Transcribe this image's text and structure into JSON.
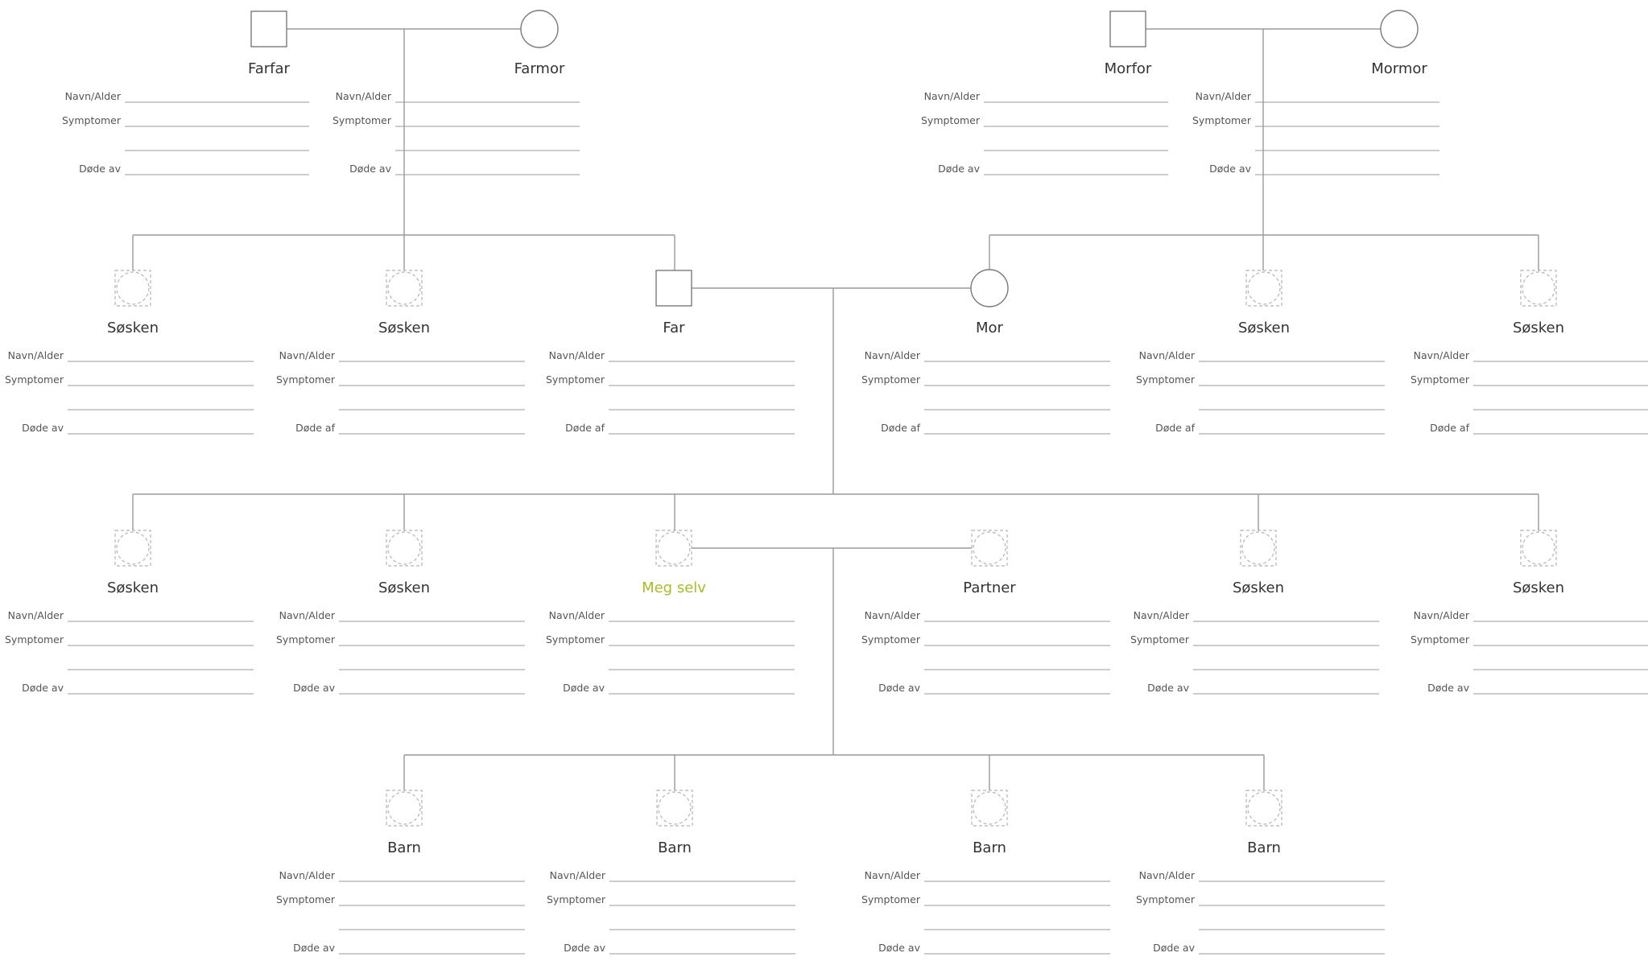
{
  "colors": {
    "line": "#9a9a9a",
    "shape": "#7a7a7a",
    "unknown_shape": "#b5b5b5",
    "self_accent": "#a9ba2a",
    "text": "#333333"
  },
  "persons": [
    {
      "id": "farfar",
      "name": "Farfar",
      "shape": "square",
      "labels": [
        "Navn/Alder",
        "Symptomer",
        "",
        "Døde av"
      ]
    },
    {
      "id": "farmor",
      "name": "Farmor",
      "shape": "circle",
      "labels": [
        "Navn/Alder",
        "Symptomer",
        "",
        "Døde av"
      ]
    },
    {
      "id": "morfor",
      "name": "Morfor",
      "shape": "square",
      "labels": [
        "Navn/Alder",
        "Symptomer",
        "",
        "Døde av"
      ]
    },
    {
      "id": "mormor",
      "name": "Mormor",
      "shape": "circle",
      "labels": [
        "Navn/Alder",
        "Symptomer",
        "",
        "Døde av"
      ]
    },
    {
      "id": "f-sib-1",
      "name": "Søsken",
      "shape": "unknown",
      "labels": [
        "Navn/Alder",
        "Symptomer",
        "",
        "Døde av"
      ]
    },
    {
      "id": "f-sib-2",
      "name": "Søsken",
      "shape": "unknown",
      "labels": [
        "Navn/Alder",
        "Symptomer",
        "",
        "Døde af"
      ]
    },
    {
      "id": "far",
      "name": "Far",
      "shape": "square",
      "labels": [
        "Navn/Alder",
        "Symptomer",
        "",
        "Døde af"
      ]
    },
    {
      "id": "mor",
      "name": "Mor",
      "shape": "circle",
      "labels": [
        "Navn/Alder",
        "Symptomer",
        "",
        "Døde af"
      ]
    },
    {
      "id": "m-sib-1",
      "name": "Søsken",
      "shape": "unknown",
      "labels": [
        "Navn/Alder",
        "Symptomer",
        "",
        "Døde af"
      ]
    },
    {
      "id": "m-sib-2",
      "name": "Søsken",
      "shape": "unknown",
      "labels": [
        "Navn/Alder",
        "Symptomer",
        "",
        "Døde af"
      ]
    },
    {
      "id": "sib-1",
      "name": "Søsken",
      "shape": "unknown",
      "labels": [
        "Navn/Alder",
        "Symptomer",
        "",
        "Døde av"
      ]
    },
    {
      "id": "sib-2",
      "name": "Søsken",
      "shape": "unknown",
      "labels": [
        "Navn/Alder",
        "Symptomer",
        "",
        "Døde av"
      ]
    },
    {
      "id": "self",
      "name": "Meg selv",
      "shape": "unknown",
      "highlight": true,
      "labels": [
        "Navn/Alder",
        "Symptomer",
        "",
        "Døde av"
      ]
    },
    {
      "id": "partner",
      "name": "Partner",
      "shape": "unknown",
      "labels": [
        "Navn/Alder",
        "Symptomer",
        "",
        "Døde av"
      ]
    },
    {
      "id": "sib-3",
      "name": "Søsken",
      "shape": "unknown",
      "labels": [
        "Navn/Alder",
        "Symptomer",
        "",
        "Døde av"
      ]
    },
    {
      "id": "sib-4",
      "name": "Søsken",
      "shape": "unknown",
      "labels": [
        "Navn/Alder",
        "Symptomer",
        "",
        "Døde av"
      ]
    },
    {
      "id": "child-1",
      "name": "Barn",
      "shape": "unknown",
      "labels": [
        "Navn/Alder",
        "Symptomer",
        "",
        "Døde av"
      ]
    },
    {
      "id": "child-2",
      "name": "Barn",
      "shape": "unknown",
      "labels": [
        "Navn/Alder",
        "Symptomer",
        "",
        "Døde av"
      ]
    },
    {
      "id": "child-3",
      "name": "Barn",
      "shape": "unknown",
      "labels": [
        "Navn/Alder",
        "Symptomer",
        "",
        "Døde av"
      ]
    },
    {
      "id": "child-4",
      "name": "Barn",
      "shape": "unknown",
      "labels": [
        "Navn/Alder",
        "Symptomer",
        "",
        "Døde av"
      ]
    }
  ]
}
